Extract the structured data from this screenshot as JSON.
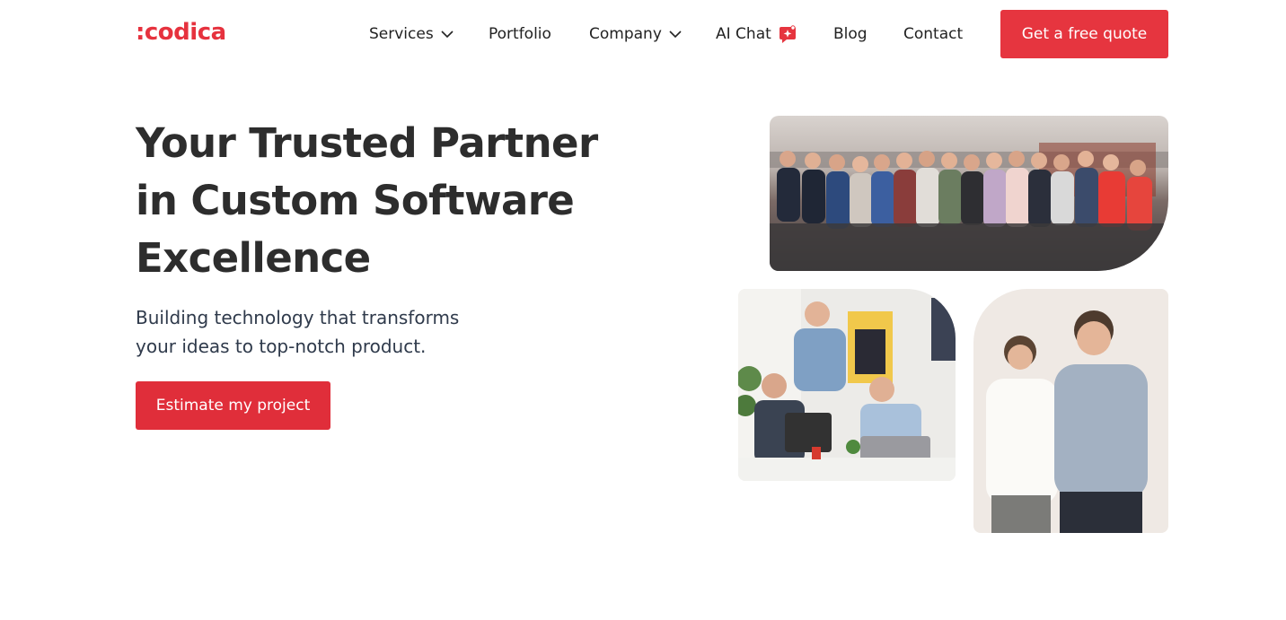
{
  "brand": {
    "logo_text": ":codica",
    "accent_color": "#e6353f"
  },
  "nav": {
    "items": [
      {
        "label": "Services",
        "has_dropdown": true
      },
      {
        "label": "Portfolio",
        "has_dropdown": false
      },
      {
        "label": "Company",
        "has_dropdown": true
      },
      {
        "label": "AI Chat",
        "has_badge": true,
        "badge_icon": "sparkle-chat-icon"
      },
      {
        "label": "Blog",
        "has_dropdown": false
      },
      {
        "label": "Contact",
        "has_dropdown": false
      }
    ],
    "cta_label": "Get a free quote"
  },
  "hero": {
    "title_lines": [
      "Your Trusted Partner",
      "in Custom Software",
      "Excellence"
    ],
    "subtitle_lines": [
      "Building technology that transforms",
      "your ideas to top-notch product."
    ],
    "cta_label": "Estimate my project"
  },
  "photos": [
    {
      "name": "team-photo",
      "icon": "team-group-photo"
    },
    {
      "name": "office-photo",
      "icon": "office-work-photo"
    },
    {
      "name": "founders-photo",
      "icon": "founders-portrait-photo"
    }
  ]
}
